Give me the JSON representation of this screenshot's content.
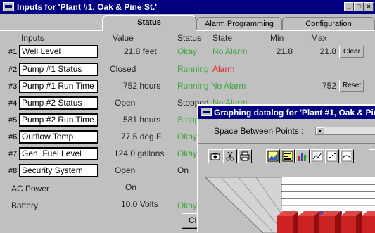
{
  "window": {
    "title": "Inputs for 'Plant #1, Oak & Pine St.'",
    "minimize": "_",
    "maximize": "□",
    "close": "×"
  },
  "tabs": [
    "Status",
    "Alarm Programming",
    "Configuration"
  ],
  "headers": {
    "inputs": "Inputs",
    "value": "Value",
    "status": "Status",
    "state": "State",
    "min": "Min",
    "max": "Max"
  },
  "rows": [
    {
      "num": "#1",
      "name": "Well Level",
      "value": "21.8 feet",
      "status": "Okay",
      "state": "No Alarm",
      "min": "21.8",
      "max": "21.8",
      "button": "Clear"
    },
    {
      "num": "#2",
      "name": "Pump #1 Status",
      "value": "Closed",
      "status": "Running",
      "state": "Alarm",
      "min": "",
      "max": "",
      "button": ""
    },
    {
      "num": "#3",
      "name": "Pump #1 Run Time",
      "value": "752 hours",
      "status": "Running",
      "state": "No Alarm",
      "min": "",
      "max": "752",
      "button": "Reset"
    },
    {
      "num": "#4",
      "name": "Pump #2 Status",
      "value": "Open",
      "status": "Stopped",
      "state": "No Alarm",
      "min": "",
      "max": "",
      "button": ""
    },
    {
      "num": "#5",
      "name": "Pump #2 Run Time",
      "value": "581 hours",
      "status": "Stopp",
      "state": "",
      "min": "",
      "max": "",
      "button": ""
    },
    {
      "num": "#6",
      "name": "Outflow Temp",
      "value": "77.5 deg F",
      "status": "Okay",
      "state": "",
      "min": "",
      "max": "",
      "button": ""
    },
    {
      "num": "#7",
      "name": "Gen. Fuel Level",
      "value": "124.0 gallons",
      "status": "Okay",
      "state": "",
      "min": "",
      "max": "",
      "button": ""
    },
    {
      "num": "#8",
      "name": "Security System",
      "value": "Open",
      "status": "On",
      "state": "",
      "min": "",
      "max": "",
      "button": ""
    },
    {
      "num": "",
      "name": "AC Power",
      "value": "On",
      "status": "",
      "state": "",
      "min": "",
      "max": "",
      "button": ""
    },
    {
      "num": "",
      "name": "Battery",
      "value": "10.0 Volts",
      "status": "Okay",
      "state": "",
      "min": "",
      "max": "",
      "button": ""
    }
  ],
  "bottom_button": "Cl",
  "colors": {
    "title_bar": "#000080",
    "okay": "#3aa83a",
    "alarm": "#e02020",
    "bars": "#cc2222"
  },
  "graph_window": {
    "title": "Graphing datalog for 'Plant #1, Oak & Pin",
    "spacing_label": "Space Between Points :",
    "toolbar": [
      "camera-icon",
      "scissors-icon",
      "printer-icon",
      "area-chart-icon",
      "horizontal-bar-icon",
      "bar-chart-icon",
      "line-chart-icon",
      "scatter-icon",
      "curve-icon",
      "more-icon"
    ]
  }
}
